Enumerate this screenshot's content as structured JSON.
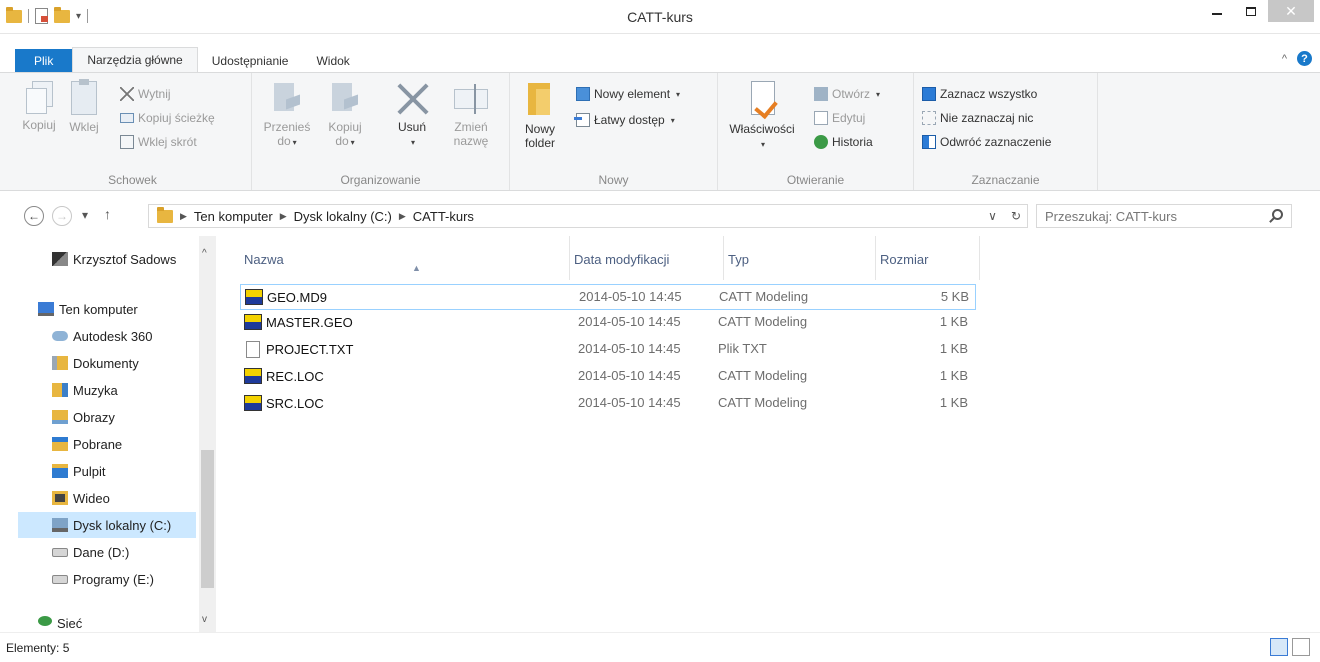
{
  "window": {
    "title": "CATT-kurs",
    "close_glyph": "✕"
  },
  "ribbon_tabs": [
    {
      "label": "Plik"
    },
    {
      "label": "Narzędzia główne"
    },
    {
      "label": "Udostępnianie"
    },
    {
      "label": "Widok"
    }
  ],
  "help_glyph": "?",
  "collapse_glyph": "^",
  "ribbon": {
    "schowek": {
      "label": "Schowek",
      "copy": "Kopiuj",
      "paste": "Wklej",
      "cut": "Wytnij",
      "copy_path": "Kopiuj ścieżkę",
      "paste_shortcut": "Wklej skrót"
    },
    "organize": {
      "label": "Organizowanie",
      "move_to": [
        "Przenieś",
        "do"
      ],
      "copy_to": [
        "Kopiuj",
        "do"
      ],
      "delete": "Usuń",
      "rename": [
        "Zmień",
        "nazwę"
      ]
    },
    "new": {
      "label": "Nowy",
      "new_folder": [
        "Nowy",
        "folder"
      ],
      "new_item": "Nowy element",
      "easy_access": "Łatwy dostęp"
    },
    "open": {
      "label": "Otwieranie",
      "properties": "Właściwości",
      "open": "Otwórz",
      "edit": "Edytuj",
      "history": "Historia"
    },
    "select": {
      "label": "Zaznaczanie",
      "select_all": "Zaznacz wszystko",
      "select_none": "Nie zaznaczaj nic",
      "invert": "Odwróć zaznaczenie"
    }
  },
  "address": {
    "crumbs": [
      "Ten komputer",
      "Dysk lokalny (C:)",
      "CATT-kurs"
    ],
    "search_placeholder": "Przeszukaj: CATT-kurs"
  },
  "nav_pane": {
    "items": [
      {
        "label": "Krzysztof Sadows",
        "icon": "user-icon"
      },
      {
        "label": "Ten komputer",
        "icon": "computer-icon"
      },
      {
        "label": "Autodesk 360",
        "icon": "cloud-icon"
      },
      {
        "label": "Dokumenty",
        "icon": "documents-icon"
      },
      {
        "label": "Muzyka",
        "icon": "music-icon"
      },
      {
        "label": "Obrazy",
        "icon": "pictures-icon"
      },
      {
        "label": "Pobrane",
        "icon": "downloads-icon"
      },
      {
        "label": "Pulpit",
        "icon": "desktop-icon"
      },
      {
        "label": "Wideo",
        "icon": "video-icon"
      },
      {
        "label": "Dysk lokalny (C:)",
        "icon": "local-disk-icon"
      },
      {
        "label": "Dane (D:)",
        "icon": "drive-icon"
      },
      {
        "label": "Programy (E:)",
        "icon": "drive-icon"
      },
      {
        "label": "Sieć",
        "icon": "network-icon"
      }
    ],
    "selected": "Dysk lokalny (C:)"
  },
  "file_list": {
    "columns": [
      "Nazwa",
      "Data modyfikacji",
      "Typ",
      "Rozmiar"
    ],
    "rows": [
      {
        "name": "GEO.MD9",
        "date": "2014-05-10 14:45",
        "type": "CATT Modeling",
        "size": "5 KB",
        "icon": "catt-file-icon"
      },
      {
        "name": "MASTER.GEO",
        "date": "2014-05-10 14:45",
        "type": "CATT Modeling",
        "size": "1 KB",
        "icon": "catt-file-icon"
      },
      {
        "name": "PROJECT.TXT",
        "date": "2014-05-10 14:45",
        "type": "Plik TXT",
        "size": "1 KB",
        "icon": "text-file-icon"
      },
      {
        "name": "REC.LOC",
        "date": "2014-05-10 14:45",
        "type": "CATT Modeling",
        "size": "1 KB",
        "icon": "catt-file-icon"
      },
      {
        "name": "SRC.LOC",
        "date": "2014-05-10 14:45",
        "type": "CATT Modeling",
        "size": "1 KB",
        "icon": "catt-file-icon"
      }
    ],
    "selected_row": "GEO.MD9"
  },
  "status": {
    "items_count": "Elementy: 5"
  }
}
